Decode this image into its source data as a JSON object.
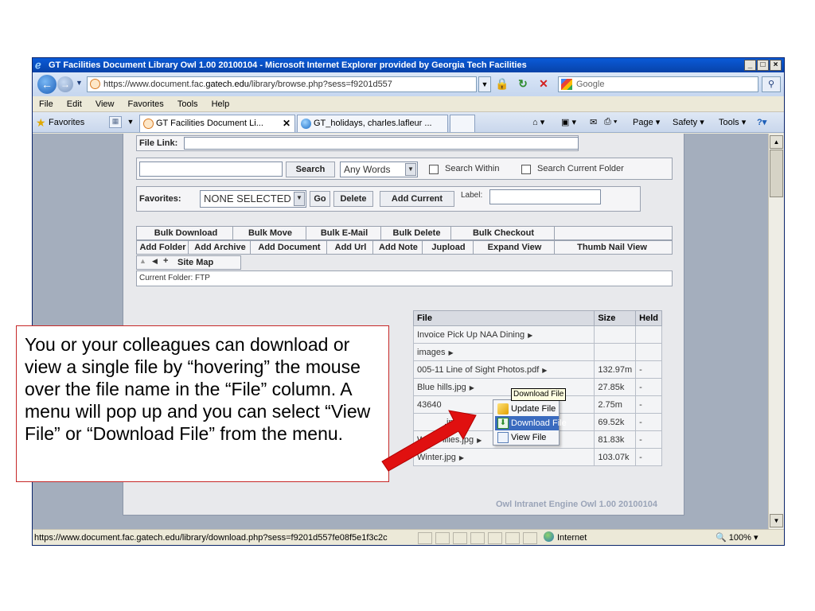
{
  "window": {
    "title": "GT Facilities Document Library Owl 1.00 20100104 - Microsoft Internet Explorer provided by Georgia Tech Facilities"
  },
  "address": {
    "url_prefix": "https://www.document.fac.",
    "url_domain": "gatech.edu",
    "url_rest": "/library/browse.php?sess=f9201d557",
    "search_placeholder": "Google"
  },
  "menu": [
    "File",
    "Edit",
    "View",
    "Favorites",
    "Tools",
    "Help"
  ],
  "tabs": {
    "favorites_label": "Favorites",
    "tab1": "GT Facilities Document Li...",
    "tab2": "GT_holidays, charles.lafleur ...",
    "cmd_page": "Page",
    "cmd_safety": "Safety",
    "cmd_tools": "Tools"
  },
  "page": {
    "file_link_label": "File Link:",
    "search_btn": "Search",
    "any_words": "Any Words",
    "search_within": "Search Within",
    "search_current_folder": "Search Current Folder",
    "favorites_label": "Favorites:",
    "none_selected": "NONE SELECTED",
    "go_btn": "Go",
    "delete_btn": "Delete",
    "add_current_btn": "Add Current",
    "label_label": "Label:",
    "toolbar1": [
      "Bulk Download",
      "Bulk Move",
      "Bulk E-Mail",
      "Bulk Delete",
      "Bulk Checkout"
    ],
    "toolbar2": [
      "Add Folder",
      "Add Archive",
      "Add Document",
      "Add Url",
      "Add Note",
      "Jupload",
      "Expand View",
      "Thumb Nail View"
    ],
    "site_map": "Site Map",
    "current_folder": "Current Folder: FTP",
    "headers": {
      "file": "File",
      "size": "Size",
      "held": "Held"
    },
    "rows": [
      {
        "file": "Invoice Pick Up NAA Dining",
        "size": "",
        "held": ""
      },
      {
        "file": "images",
        "size": "",
        "held": ""
      },
      {
        "file": "005-11 Line of Sight Photos.pdf",
        "size": "132.97m",
        "held": "-"
      },
      {
        "file": "Blue hills.jpg",
        "size": "27.85k",
        "held": "-"
      },
      {
        "file": "43640",
        "size": "2.75m",
        "held": "-"
      },
      {
        "file": ".jpg",
        "size": "69.52k",
        "held": "-"
      },
      {
        "file": "Water lilies.jpg",
        "size": "81.83k",
        "held": "-"
      },
      {
        "file": "Winter.jpg",
        "size": "103.07k",
        "held": "-"
      }
    ],
    "popup": [
      "Update File",
      "Download File",
      "View File"
    ],
    "tooltip": "Download File",
    "footer": "Owl Intranet Engine Owl 1.00 20100104"
  },
  "status": {
    "url": "https://www.document.fac.gatech.edu/library/download.php?sess=f9201d557fe08f5e1f3c2c",
    "zone": "Internet",
    "zoom": "100%"
  },
  "callout": {
    "text": "You or your colleagues can download or view a single file by “hovering” the mouse over the file name in the “File” column.  A menu will pop up and you can select “View File” or “Download File” from the menu."
  }
}
